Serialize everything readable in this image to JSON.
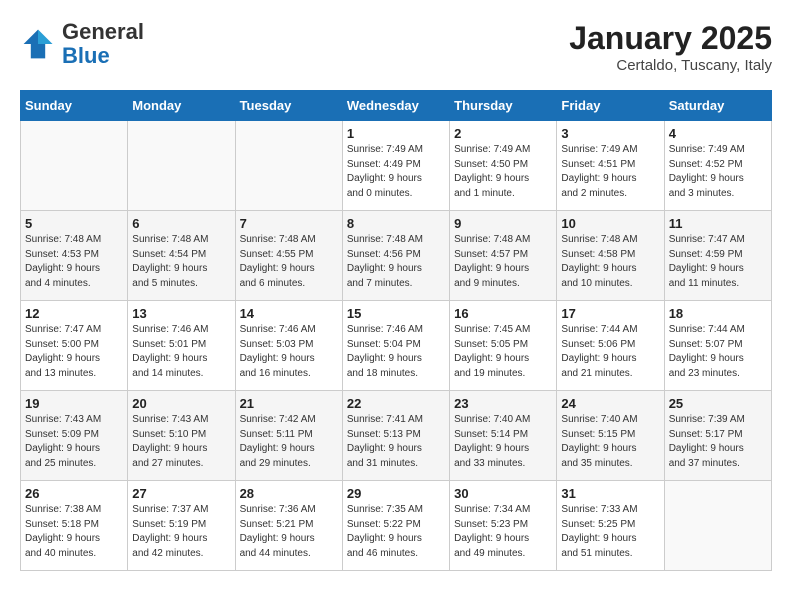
{
  "logo": {
    "general": "General",
    "blue": "Blue"
  },
  "title": "January 2025",
  "location": "Certaldo, Tuscany, Italy",
  "days_of_week": [
    "Sunday",
    "Monday",
    "Tuesday",
    "Wednesday",
    "Thursday",
    "Friday",
    "Saturday"
  ],
  "weeks": [
    [
      {
        "day": "",
        "info": ""
      },
      {
        "day": "",
        "info": ""
      },
      {
        "day": "",
        "info": ""
      },
      {
        "day": "1",
        "info": "Sunrise: 7:49 AM\nSunset: 4:49 PM\nDaylight: 9 hours\nand 0 minutes."
      },
      {
        "day": "2",
        "info": "Sunrise: 7:49 AM\nSunset: 4:50 PM\nDaylight: 9 hours\nand 1 minute."
      },
      {
        "day": "3",
        "info": "Sunrise: 7:49 AM\nSunset: 4:51 PM\nDaylight: 9 hours\nand 2 minutes."
      },
      {
        "day": "4",
        "info": "Sunrise: 7:49 AM\nSunset: 4:52 PM\nDaylight: 9 hours\nand 3 minutes."
      }
    ],
    [
      {
        "day": "5",
        "info": "Sunrise: 7:48 AM\nSunset: 4:53 PM\nDaylight: 9 hours\nand 4 minutes."
      },
      {
        "day": "6",
        "info": "Sunrise: 7:48 AM\nSunset: 4:54 PM\nDaylight: 9 hours\nand 5 minutes."
      },
      {
        "day": "7",
        "info": "Sunrise: 7:48 AM\nSunset: 4:55 PM\nDaylight: 9 hours\nand 6 minutes."
      },
      {
        "day": "8",
        "info": "Sunrise: 7:48 AM\nSunset: 4:56 PM\nDaylight: 9 hours\nand 7 minutes."
      },
      {
        "day": "9",
        "info": "Sunrise: 7:48 AM\nSunset: 4:57 PM\nDaylight: 9 hours\nand 9 minutes."
      },
      {
        "day": "10",
        "info": "Sunrise: 7:48 AM\nSunset: 4:58 PM\nDaylight: 9 hours\nand 10 minutes."
      },
      {
        "day": "11",
        "info": "Sunrise: 7:47 AM\nSunset: 4:59 PM\nDaylight: 9 hours\nand 11 minutes."
      }
    ],
    [
      {
        "day": "12",
        "info": "Sunrise: 7:47 AM\nSunset: 5:00 PM\nDaylight: 9 hours\nand 13 minutes."
      },
      {
        "day": "13",
        "info": "Sunrise: 7:46 AM\nSunset: 5:01 PM\nDaylight: 9 hours\nand 14 minutes."
      },
      {
        "day": "14",
        "info": "Sunrise: 7:46 AM\nSunset: 5:03 PM\nDaylight: 9 hours\nand 16 minutes."
      },
      {
        "day": "15",
        "info": "Sunrise: 7:46 AM\nSunset: 5:04 PM\nDaylight: 9 hours\nand 18 minutes."
      },
      {
        "day": "16",
        "info": "Sunrise: 7:45 AM\nSunset: 5:05 PM\nDaylight: 9 hours\nand 19 minutes."
      },
      {
        "day": "17",
        "info": "Sunrise: 7:44 AM\nSunset: 5:06 PM\nDaylight: 9 hours\nand 21 minutes."
      },
      {
        "day": "18",
        "info": "Sunrise: 7:44 AM\nSunset: 5:07 PM\nDaylight: 9 hours\nand 23 minutes."
      }
    ],
    [
      {
        "day": "19",
        "info": "Sunrise: 7:43 AM\nSunset: 5:09 PM\nDaylight: 9 hours\nand 25 minutes."
      },
      {
        "day": "20",
        "info": "Sunrise: 7:43 AM\nSunset: 5:10 PM\nDaylight: 9 hours\nand 27 minutes."
      },
      {
        "day": "21",
        "info": "Sunrise: 7:42 AM\nSunset: 5:11 PM\nDaylight: 9 hours\nand 29 minutes."
      },
      {
        "day": "22",
        "info": "Sunrise: 7:41 AM\nSunset: 5:13 PM\nDaylight: 9 hours\nand 31 minutes."
      },
      {
        "day": "23",
        "info": "Sunrise: 7:40 AM\nSunset: 5:14 PM\nDaylight: 9 hours\nand 33 minutes."
      },
      {
        "day": "24",
        "info": "Sunrise: 7:40 AM\nSunset: 5:15 PM\nDaylight: 9 hours\nand 35 minutes."
      },
      {
        "day": "25",
        "info": "Sunrise: 7:39 AM\nSunset: 5:17 PM\nDaylight: 9 hours\nand 37 minutes."
      }
    ],
    [
      {
        "day": "26",
        "info": "Sunrise: 7:38 AM\nSunset: 5:18 PM\nDaylight: 9 hours\nand 40 minutes."
      },
      {
        "day": "27",
        "info": "Sunrise: 7:37 AM\nSunset: 5:19 PM\nDaylight: 9 hours\nand 42 minutes."
      },
      {
        "day": "28",
        "info": "Sunrise: 7:36 AM\nSunset: 5:21 PM\nDaylight: 9 hours\nand 44 minutes."
      },
      {
        "day": "29",
        "info": "Sunrise: 7:35 AM\nSunset: 5:22 PM\nDaylight: 9 hours\nand 46 minutes."
      },
      {
        "day": "30",
        "info": "Sunrise: 7:34 AM\nSunset: 5:23 PM\nDaylight: 9 hours\nand 49 minutes."
      },
      {
        "day": "31",
        "info": "Sunrise: 7:33 AM\nSunset: 5:25 PM\nDaylight: 9 hours\nand 51 minutes."
      },
      {
        "day": "",
        "info": ""
      }
    ]
  ]
}
